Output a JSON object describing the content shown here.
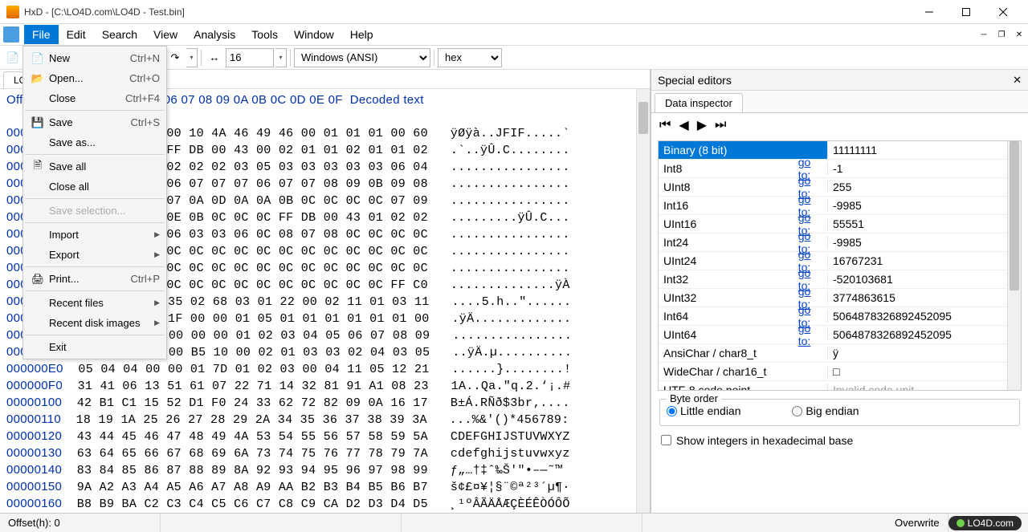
{
  "window": {
    "title": "HxD - [C:\\LO4D.com\\LO4D - Test.bin]"
  },
  "menu": {
    "file": "File",
    "edit": "Edit",
    "search": "Search",
    "view": "View",
    "analysis": "Analysis",
    "tools": "Tools",
    "window": "Window",
    "help": "Help"
  },
  "file_menu": {
    "new": {
      "label": "New",
      "shortcut": "Ctrl+N"
    },
    "open": {
      "label": "Open...",
      "shortcut": "Ctrl+O"
    },
    "close": {
      "label": "Close",
      "shortcut": "Ctrl+F4"
    },
    "save": {
      "label": "Save",
      "shortcut": "Ctrl+S"
    },
    "save_as": {
      "label": "Save as..."
    },
    "save_all": {
      "label": "Save all"
    },
    "close_all": {
      "label": "Close all"
    },
    "save_selection": {
      "label": "Save selection..."
    },
    "import": {
      "label": "Import"
    },
    "export": {
      "label": "Export"
    },
    "print": {
      "label": "Print...",
      "shortcut": "Ctrl+P"
    },
    "recent_files": {
      "label": "Recent files"
    },
    "recent_disk": {
      "label": "Recent disk images"
    },
    "exit": {
      "label": "Exit"
    }
  },
  "toolbar": {
    "bytes_per_row": "16",
    "encoding": "Windows (ANSI)",
    "base": "hex"
  },
  "file_tab": "LO4D - Test.bin",
  "hex_header": "Offset(h) 00 01 02 03 04 05 06 07 08 09 0A 0B 0C 0D 0E 0F  Decoded text",
  "hex_rows": [
    {
      "off": "00000000",
      "bytes": "FF D8 FF E0 00 10 4A 46 49 46 00 01 01 01 00 60",
      "text": "ÿØÿà..JFIF.....`"
    },
    {
      "off": "00000010",
      "bytes": "00 60 00 00 FF DB 00 43 00 02 01 01 02 01 01 02",
      "text": ".`..ÿÛ.C........"
    },
    {
      "off": "00000020",
      "bytes": "02 02 02 02 02 02 02 03 05 03 03 03 03 03 06 04",
      "text": "................"
    },
    {
      "off": "00000030",
      "bytes": "04 03 05 07 06 07 07 07 06 07 07 08 09 0B 09 08",
      "text": "................"
    },
    {
      "off": "00000040",
      "bytes": "08 0A 08 07 07 0A 0D 0A 0A 0B 0C 0C 0C 0C 07 09",
      "text": "................"
    },
    {
      "off": "00000050",
      "bytes": "0E 0F 0D 0C 0E 0B 0C 0C 0C FF DB 00 43 01 02 02",
      "text": ".........ÿÛ.C..."
    },
    {
      "off": "00000060",
      "bytes": "02 03 03 03 06 03 03 06 0C 08 07 08 0C 0C 0C 0C",
      "text": "................"
    },
    {
      "off": "00000070",
      "bytes": "0C 0C 0C 0C 0C 0C 0C 0C 0C 0C 0C 0C 0C 0C 0C 0C",
      "text": "................"
    },
    {
      "off": "00000080",
      "bytes": "0C 0C 0C 0C 0C 0C 0C 0C 0C 0C 0C 0C 0C 0C 0C 0C",
      "text": "................"
    },
    {
      "off": "00000090",
      "bytes": "0C 0C 0C 0C 0C 0C 0C 0C 0C 0C 0C 0C 0C 0C FF C0",
      "text": "..............ÿÀ"
    },
    {
      "off": "000000A0",
      "bytes": "00 11 08 02 35 02 68 03 01 22 00 02 11 01 03 11",
      "text": "....5.h..\"......"
    },
    {
      "off": "000000B0",
      "bytes": "01 FF C4 00 1F 00 00 01 05 01 01 01 01 01 01 00",
      "text": ".ÿÄ............."
    },
    {
      "off": "000000C0",
      "bytes": "00 00 00 00 00 00 00 01 02 03 04 05 06 07 08 09",
      "text": "................"
    },
    {
      "off": "000000D0",
      "bytes": "0A 0B FF C4 00 B5 10 00 02 01 03 03 02 04 03 05",
      "text": "..ÿÄ.µ.........."
    },
    {
      "off": "000000E0",
      "bytes": "05 04 04 00 00 01 7D 01 02 03 00 04 11 05 12 21",
      "text": "......}........!"
    },
    {
      "off": "000000F0",
      "bytes": "31 41 06 13 51 61 07 22 71 14 32 81 91 A1 08 23",
      "text": "1A..Qa.\"q.2.‘¡.#"
    },
    {
      "off": "00000100",
      "bytes": "42 B1 C1 15 52 D1 F0 24 33 62 72 82 09 0A 16 17",
      "text": "B±Á.RÑð$3br‚...."
    },
    {
      "off": "00000110",
      "bytes": "18 19 1A 25 26 27 28 29 2A 34 35 36 37 38 39 3A",
      "text": "...%&'()*456789:"
    },
    {
      "off": "00000120",
      "bytes": "43 44 45 46 47 48 49 4A 53 54 55 56 57 58 59 5A",
      "text": "CDEFGHIJSTUVWXYZ"
    },
    {
      "off": "00000130",
      "bytes": "63 64 65 66 67 68 69 6A 73 74 75 76 77 78 79 7A",
      "text": "cdefghijstuvwxyz"
    },
    {
      "off": "00000140",
      "bytes": "83 84 85 86 87 88 89 8A 92 93 94 95 96 97 98 99",
      "text": "ƒ„…†‡ˆ‰Š'\"•–—˜™"
    },
    {
      "off": "00000150",
      "bytes": "9A A2 A3 A4 A5 A6 A7 A8 A9 AA B2 B3 B4 B5 B6 B7",
      "text": "š¢£¤¥¦§¨©ª²³´µ¶·"
    },
    {
      "off": "00000160",
      "bytes": "B8 B9 BA C2 C3 C4 C5 C6 C7 C8 C9 CA D2 D3 D4 D5",
      "text": "¸¹ºÂÃÄÅÆÇÈÉÊÒÓÔÕ"
    }
  ],
  "special_editors": {
    "title": "Special editors",
    "tab": "Data inspector",
    "rows": [
      {
        "name": "Binary (8 bit)",
        "goto": false,
        "value": "11111111",
        "selected": true
      },
      {
        "name": "Int8",
        "goto": true,
        "value": "-1"
      },
      {
        "name": "UInt8",
        "goto": true,
        "value": "255"
      },
      {
        "name": "Int16",
        "goto": true,
        "value": "-9985"
      },
      {
        "name": "UInt16",
        "goto": true,
        "value": "55551"
      },
      {
        "name": "Int24",
        "goto": true,
        "value": "-9985"
      },
      {
        "name": "UInt24",
        "goto": true,
        "value": "16767231"
      },
      {
        "name": "Int32",
        "goto": true,
        "value": "-520103681"
      },
      {
        "name": "UInt32",
        "goto": true,
        "value": "3774863615"
      },
      {
        "name": "Int64",
        "goto": true,
        "value": "5064878326892452095"
      },
      {
        "name": "UInt64",
        "goto": true,
        "value": "5064878326892452095"
      },
      {
        "name": "AnsiChar / char8_t",
        "goto": false,
        "value": "ÿ"
      },
      {
        "name": "WideChar / char16_t",
        "goto": false,
        "value": "□"
      },
      {
        "name": "UTF-8 code point",
        "goto": false,
        "value": "Invalid code unit",
        "disabled": true
      }
    ],
    "goto_label": "go to:",
    "byte_order_legend": "Byte order",
    "little_endian": "Little endian",
    "big_endian": "Big endian",
    "hex_base_check": "Show integers in hexadecimal base"
  },
  "status": {
    "offset": "Offset(h): 0",
    "overwrite": "Overwrite",
    "badge": "LO4D.com"
  }
}
